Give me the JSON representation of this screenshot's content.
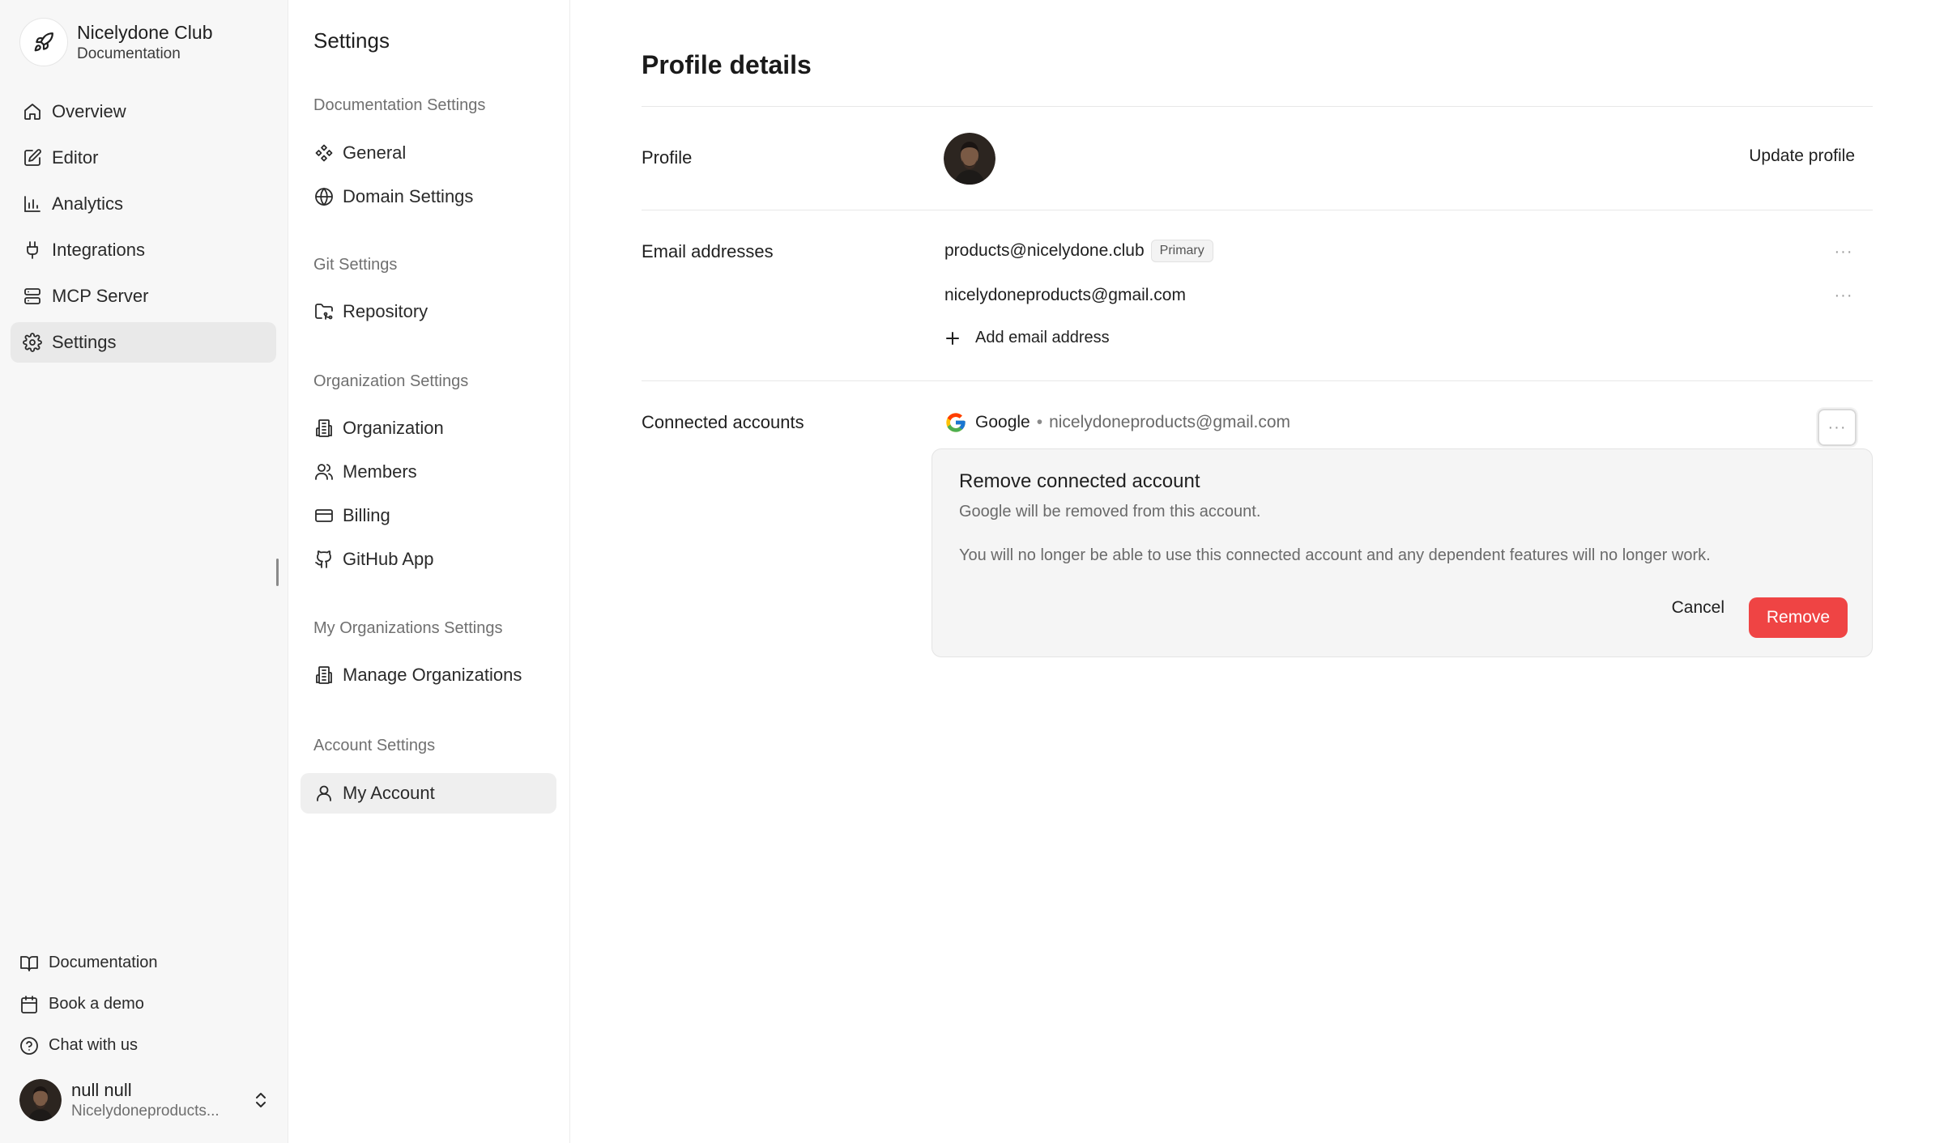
{
  "brand": {
    "name": "Nicelydone Club",
    "subtitle": "Documentation"
  },
  "nav": {
    "items": [
      {
        "label": "Overview",
        "icon": "home-icon"
      },
      {
        "label": "Editor",
        "icon": "edit-icon"
      },
      {
        "label": "Analytics",
        "icon": "bar-chart-icon"
      },
      {
        "label": "Integrations",
        "icon": "plug-icon"
      },
      {
        "label": "MCP Server",
        "icon": "server-icon"
      },
      {
        "label": "Settings",
        "icon": "gear-icon",
        "active": true
      }
    ]
  },
  "footer_links": [
    {
      "label": "Documentation",
      "icon": "book-icon"
    },
    {
      "label": "Book a demo",
      "icon": "calendar-icon"
    },
    {
      "label": "Chat with us",
      "icon": "help-circle-icon"
    }
  ],
  "user": {
    "name": "null null",
    "email": "Nicelydoneproducts..."
  },
  "settings": {
    "title": "Settings",
    "groups": [
      {
        "label": "Documentation Settings",
        "items": [
          "General",
          "Domain Settings"
        ]
      },
      {
        "label": "Git Settings",
        "items": [
          "Repository"
        ]
      },
      {
        "label": "Organization Settings",
        "items": [
          "Organization",
          "Members",
          "Billing",
          "GitHub App"
        ]
      },
      {
        "label": "My Organizations Settings",
        "items": [
          "Manage Organizations"
        ]
      },
      {
        "label": "Account Settings",
        "items": [
          "My Account"
        ]
      }
    ],
    "active_item": "My Account"
  },
  "profile": {
    "page_title": "Profile details",
    "profile_label": "Profile",
    "update_profile": "Update profile",
    "emails_label": "Email addresses",
    "emails": [
      {
        "address": "products@nicelydone.club",
        "badge": "Primary"
      },
      {
        "address": "nicelydoneproducts@gmail.com"
      }
    ],
    "add_email": "Add email address",
    "connected_label": "Connected accounts",
    "connected": {
      "provider": "Google",
      "separator": "•",
      "email": "nicelydoneproducts@gmail.com"
    },
    "more_glyph": "···"
  },
  "confirm": {
    "title": "Remove connected account",
    "subtitle": "Google will be removed from this account.",
    "message": "You will no longer be able to use this connected account and any dependent features will no longer work.",
    "cancel": "Cancel",
    "remove": "Remove"
  },
  "colors": {
    "danger": "#ef4444",
    "sidebar_bg": "#f7f7f7",
    "active_bg": "#e9e9e9"
  }
}
